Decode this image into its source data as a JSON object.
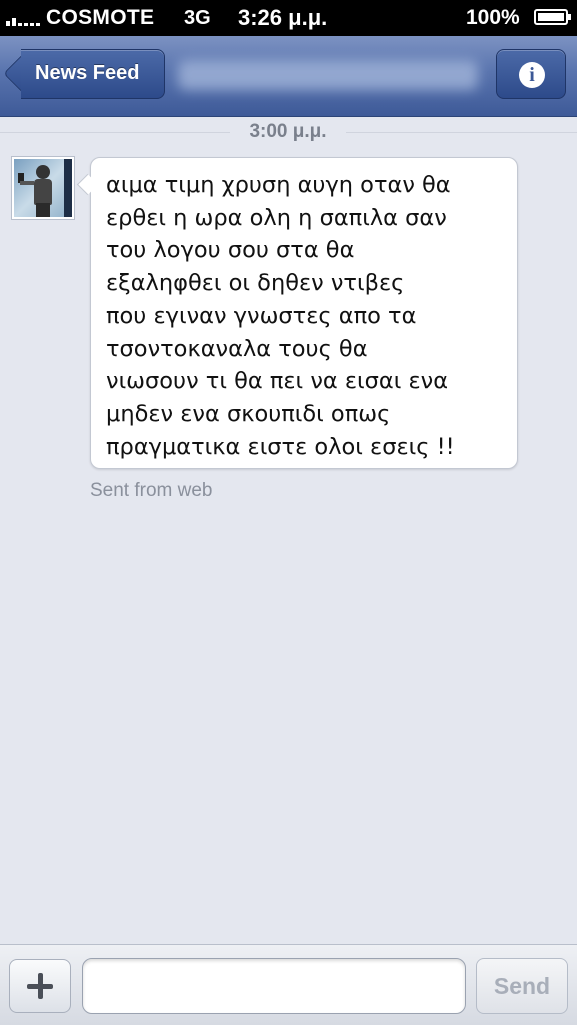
{
  "status_bar": {
    "carrier": "COSMOTE",
    "network": "3G",
    "time": "3:26 μ.μ.",
    "battery": "100%",
    "battery_level": 1.0
  },
  "nav": {
    "back_label": "News Feed",
    "title": "",
    "info_icon": "info-icon",
    "info_glyph": "i"
  },
  "conversation": {
    "timestamp": "3:00 μ.μ.",
    "message": {
      "lines": [
        "αιμα τιμη χρυση αυγη οταν θα",
        "ερθει η ωρα ολη η σαπιλα σαν",
        "του λογου σου στα θα",
        "εξαληφθει οι δηθεν ντιβες",
        "που εγιναν γνωστες απο τα",
        "τσοντοκαναλα τους θα",
        "νιωσουν τι θα πει να εισαι ενα",
        "μηδεν ενα σκουπιδι οπως",
        "πραγματικα ειστε ολοι εσεις !!"
      ],
      "source": "Sent from web"
    }
  },
  "composer": {
    "add_icon": "plus-icon",
    "input_value": "",
    "send_label": "Send"
  },
  "colors": {
    "nav_bar": "#4f6aa6",
    "background": "#e4e7ef",
    "send_disabled_text": "#a8aeb9"
  }
}
